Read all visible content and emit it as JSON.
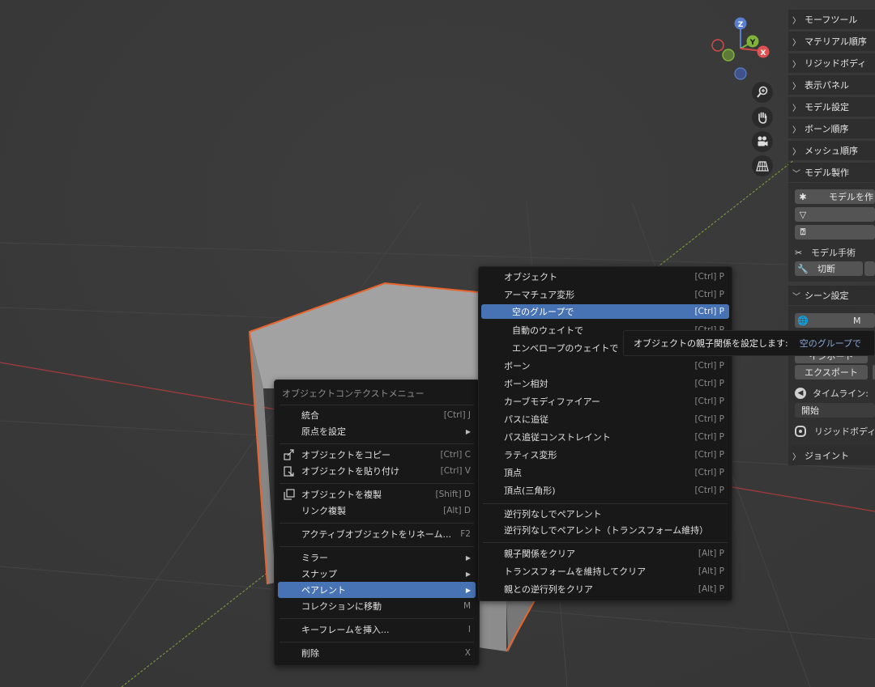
{
  "gizmo": {
    "z": "Z",
    "y": "Y",
    "x": "X"
  },
  "npanel": {
    "sections": [
      {
        "label": "モーフツール"
      },
      {
        "label": "マテリアル順序"
      },
      {
        "label": "リジッドボディ"
      },
      {
        "label": "表示パネル"
      },
      {
        "label": "モデル設定"
      },
      {
        "label": "ボーン順序"
      },
      {
        "label": "メッシュ順序"
      },
      {
        "label": "モデル製作"
      }
    ],
    "model_create_button": "モデルを作",
    "model_surgery_label": "モデル手術",
    "cut_button": "切断",
    "scene_section": "シーン設定",
    "import_button": "インポート",
    "export_button": "エクスポート",
    "timeline_label": "タイムライン:",
    "start_button": "開始",
    "rigidbody_label": "リジッドボディ",
    "joint_section": "ジョイント",
    "partial_m": "M"
  },
  "context_menu": {
    "title": "オブジェクトコンテクストメニュー",
    "items": [
      {
        "label": "統合",
        "shortcut": "[Ctrl] J"
      },
      {
        "label": "原点を設定",
        "shortcut": ""
      },
      {
        "label": "オブジェクトをコピー",
        "shortcut": "[Ctrl] C"
      },
      {
        "label": "オブジェクトを貼り付け",
        "shortcut": "[Ctrl] V"
      },
      {
        "label": "オブジェクトを複製",
        "shortcut": "[Shift] D"
      },
      {
        "label": "リンク複製",
        "shortcut": "[Alt] D"
      },
      {
        "label": "アクティブオブジェクトをリネーム...",
        "shortcut": "F2"
      },
      {
        "label": "ミラー",
        "shortcut": ""
      },
      {
        "label": "スナップ",
        "shortcut": ""
      },
      {
        "label": "ペアレント",
        "shortcut": ""
      },
      {
        "label": "コレクションに移動",
        "shortcut": "M"
      },
      {
        "label": "キーフレームを挿入...",
        "shortcut": "I"
      },
      {
        "label": "削除",
        "shortcut": "X"
      }
    ]
  },
  "parent_menu": {
    "items": [
      {
        "label": "オブジェクト",
        "shortcut": "[Ctrl] P"
      },
      {
        "label": "アーマチュア変形",
        "shortcut": "[Ctrl] P"
      },
      {
        "label": "空のグループで",
        "shortcut": "[Ctrl] P"
      },
      {
        "label": "自動のウェイトで",
        "shortcut": "[Ctrl] P"
      },
      {
        "label": "エンベロープのウェイトで",
        "shortcut": ""
      },
      {
        "label": "ボーン",
        "shortcut": "[Ctrl] P"
      },
      {
        "label": "ボーン相対",
        "shortcut": "[Ctrl] P"
      },
      {
        "label": "カーブモディファイアー",
        "shortcut": "[Ctrl] P"
      },
      {
        "label": "パスに追従",
        "shortcut": "[Ctrl] P"
      },
      {
        "label": "パス追従コンストレイント",
        "shortcut": "[Ctrl] P"
      },
      {
        "label": "ラティス変形",
        "shortcut": "[Ctrl] P"
      },
      {
        "label": "頂点",
        "shortcut": "[Ctrl] P"
      },
      {
        "label": "頂点(三角形)",
        "shortcut": "[Ctrl] P"
      },
      {
        "label": "逆行列なしでペアレント",
        "shortcut": ""
      },
      {
        "label": "逆行列なしでペアレント（トランスフォーム維持）",
        "shortcut": ""
      },
      {
        "label": "親子関係をクリア",
        "shortcut": "[Alt] P"
      },
      {
        "label": "トランスフォームを維持してクリア",
        "shortcut": "[Alt] P"
      },
      {
        "label": "親との逆行列をクリア",
        "shortcut": "[Alt] P"
      }
    ]
  },
  "tooltip": {
    "text": "オブジェクトの親子関係を設定します:",
    "highlight": "空のグループで"
  },
  "colors": {
    "highlight": "#4772b3",
    "selection_outline": "#e8642b",
    "axis_red": "#a23b3b",
    "axis_green": "#7a9a3a"
  }
}
